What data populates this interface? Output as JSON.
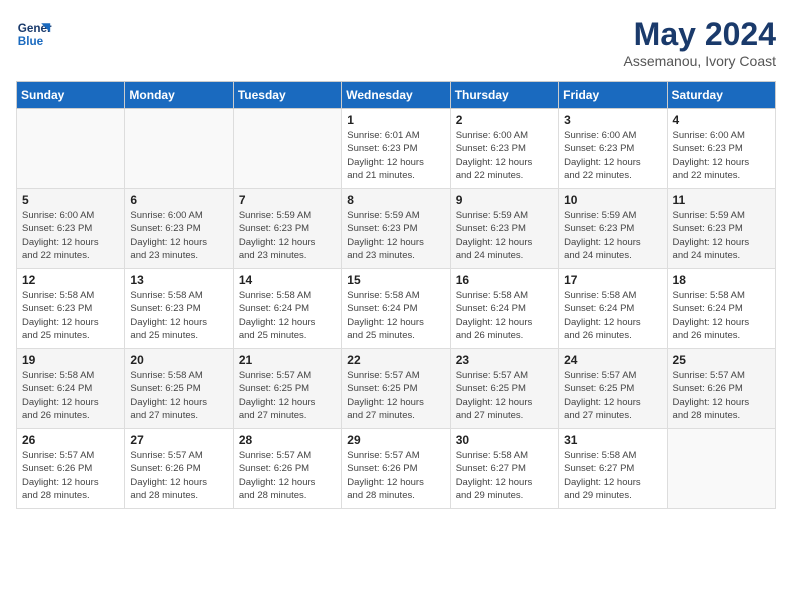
{
  "logo": {
    "line1": "General",
    "line2": "Blue"
  },
  "title": "May 2024",
  "location": "Assemanou, Ivory Coast",
  "weekdays": [
    "Sunday",
    "Monday",
    "Tuesday",
    "Wednesday",
    "Thursday",
    "Friday",
    "Saturday"
  ],
  "weeks": [
    [
      {
        "day": "",
        "info": ""
      },
      {
        "day": "",
        "info": ""
      },
      {
        "day": "",
        "info": ""
      },
      {
        "day": "1",
        "info": "Sunrise: 6:01 AM\nSunset: 6:23 PM\nDaylight: 12 hours\nand 21 minutes."
      },
      {
        "day": "2",
        "info": "Sunrise: 6:00 AM\nSunset: 6:23 PM\nDaylight: 12 hours\nand 22 minutes."
      },
      {
        "day": "3",
        "info": "Sunrise: 6:00 AM\nSunset: 6:23 PM\nDaylight: 12 hours\nand 22 minutes."
      },
      {
        "day": "4",
        "info": "Sunrise: 6:00 AM\nSunset: 6:23 PM\nDaylight: 12 hours\nand 22 minutes."
      }
    ],
    [
      {
        "day": "5",
        "info": "Sunrise: 6:00 AM\nSunset: 6:23 PM\nDaylight: 12 hours\nand 22 minutes."
      },
      {
        "day": "6",
        "info": "Sunrise: 6:00 AM\nSunset: 6:23 PM\nDaylight: 12 hours\nand 23 minutes."
      },
      {
        "day": "7",
        "info": "Sunrise: 5:59 AM\nSunset: 6:23 PM\nDaylight: 12 hours\nand 23 minutes."
      },
      {
        "day": "8",
        "info": "Sunrise: 5:59 AM\nSunset: 6:23 PM\nDaylight: 12 hours\nand 23 minutes."
      },
      {
        "day": "9",
        "info": "Sunrise: 5:59 AM\nSunset: 6:23 PM\nDaylight: 12 hours\nand 24 minutes."
      },
      {
        "day": "10",
        "info": "Sunrise: 5:59 AM\nSunset: 6:23 PM\nDaylight: 12 hours\nand 24 minutes."
      },
      {
        "day": "11",
        "info": "Sunrise: 5:59 AM\nSunset: 6:23 PM\nDaylight: 12 hours\nand 24 minutes."
      }
    ],
    [
      {
        "day": "12",
        "info": "Sunrise: 5:58 AM\nSunset: 6:23 PM\nDaylight: 12 hours\nand 25 minutes."
      },
      {
        "day": "13",
        "info": "Sunrise: 5:58 AM\nSunset: 6:23 PM\nDaylight: 12 hours\nand 25 minutes."
      },
      {
        "day": "14",
        "info": "Sunrise: 5:58 AM\nSunset: 6:24 PM\nDaylight: 12 hours\nand 25 minutes."
      },
      {
        "day": "15",
        "info": "Sunrise: 5:58 AM\nSunset: 6:24 PM\nDaylight: 12 hours\nand 25 minutes."
      },
      {
        "day": "16",
        "info": "Sunrise: 5:58 AM\nSunset: 6:24 PM\nDaylight: 12 hours\nand 26 minutes."
      },
      {
        "day": "17",
        "info": "Sunrise: 5:58 AM\nSunset: 6:24 PM\nDaylight: 12 hours\nand 26 minutes."
      },
      {
        "day": "18",
        "info": "Sunrise: 5:58 AM\nSunset: 6:24 PM\nDaylight: 12 hours\nand 26 minutes."
      }
    ],
    [
      {
        "day": "19",
        "info": "Sunrise: 5:58 AM\nSunset: 6:24 PM\nDaylight: 12 hours\nand 26 minutes."
      },
      {
        "day": "20",
        "info": "Sunrise: 5:58 AM\nSunset: 6:25 PM\nDaylight: 12 hours\nand 27 minutes."
      },
      {
        "day": "21",
        "info": "Sunrise: 5:57 AM\nSunset: 6:25 PM\nDaylight: 12 hours\nand 27 minutes."
      },
      {
        "day": "22",
        "info": "Sunrise: 5:57 AM\nSunset: 6:25 PM\nDaylight: 12 hours\nand 27 minutes."
      },
      {
        "day": "23",
        "info": "Sunrise: 5:57 AM\nSunset: 6:25 PM\nDaylight: 12 hours\nand 27 minutes."
      },
      {
        "day": "24",
        "info": "Sunrise: 5:57 AM\nSunset: 6:25 PM\nDaylight: 12 hours\nand 27 minutes."
      },
      {
        "day": "25",
        "info": "Sunrise: 5:57 AM\nSunset: 6:26 PM\nDaylight: 12 hours\nand 28 minutes."
      }
    ],
    [
      {
        "day": "26",
        "info": "Sunrise: 5:57 AM\nSunset: 6:26 PM\nDaylight: 12 hours\nand 28 minutes."
      },
      {
        "day": "27",
        "info": "Sunrise: 5:57 AM\nSunset: 6:26 PM\nDaylight: 12 hours\nand 28 minutes."
      },
      {
        "day": "28",
        "info": "Sunrise: 5:57 AM\nSunset: 6:26 PM\nDaylight: 12 hours\nand 28 minutes."
      },
      {
        "day": "29",
        "info": "Sunrise: 5:57 AM\nSunset: 6:26 PM\nDaylight: 12 hours\nand 28 minutes."
      },
      {
        "day": "30",
        "info": "Sunrise: 5:58 AM\nSunset: 6:27 PM\nDaylight: 12 hours\nand 29 minutes."
      },
      {
        "day": "31",
        "info": "Sunrise: 5:58 AM\nSunset: 6:27 PM\nDaylight: 12 hours\nand 29 minutes."
      },
      {
        "day": "",
        "info": ""
      }
    ]
  ]
}
